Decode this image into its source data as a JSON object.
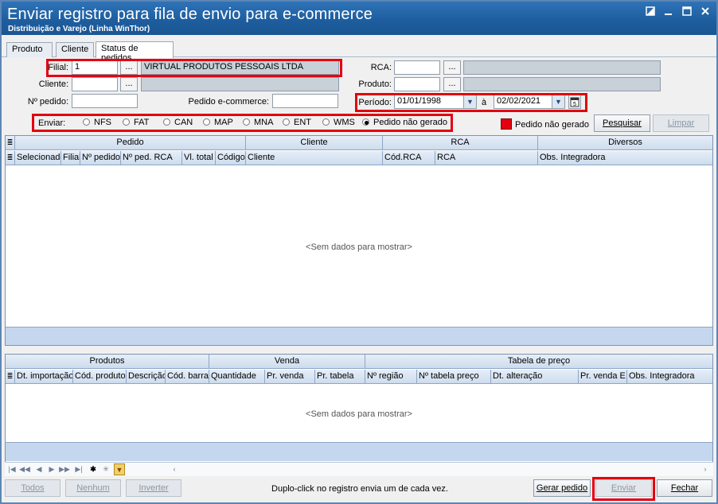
{
  "window": {
    "title": "Enviar registro para fila de envio para e-commerce",
    "subtitle": "Distribuição e Varejo (Linha WinThor)"
  },
  "tabs": [
    "Produto",
    "Cliente",
    "Status de pedidos"
  ],
  "filters": {
    "filial_label": "Filial:",
    "filial_value": "1",
    "filial_name": "VIRTUAL PRODUTOS PESSOAIS LTDA",
    "cliente_label": "Cliente:",
    "cliente_value": "",
    "pedido_label": "Nº pedido:",
    "pedido_value": "",
    "pedido_ecom_label": "Pedido e-commerce:",
    "pedido_ecom_value": "",
    "rca_label": "RCA:",
    "rca_value": "",
    "produto_label": "Produto:",
    "produto_value": "",
    "periodo_label": "Período:",
    "periodo_start": "01/01/1998",
    "periodo_sep": "à",
    "periodo_end": "02/02/2021",
    "dots": "..."
  },
  "enviar": {
    "label": "Enviar:",
    "options": [
      "NFS",
      "FAT",
      "CAN",
      "MAP",
      "MNA",
      "ENT",
      "WMS",
      "Pedido não gerado"
    ],
    "selected": "Pedido não gerado"
  },
  "legend": {
    "color": "#e3000f",
    "label": "Pedido não gerado"
  },
  "buttons": {
    "pesquisar": "Pesquisar",
    "limpar": "Limpar"
  },
  "grid1": {
    "bands": [
      "Pedido",
      "Cliente",
      "RCA",
      "Diversos"
    ],
    "columns": [
      "Selecionado",
      "Filial",
      "Nº pedido",
      "Nº ped. RCA",
      "Vl. total",
      "Código",
      "Cliente",
      "Cód.RCA",
      "RCA",
      "Obs. Integradora"
    ],
    "empty": "<Sem dados para mostrar>"
  },
  "grid2": {
    "bands": [
      "Produtos",
      "Venda",
      "Tabela de preço"
    ],
    "columns": [
      "Dt. importação",
      "Cód. produto",
      "Descrição",
      "Cód. barras",
      "Quantidade",
      "Pr. venda",
      "Pr. tabela",
      "Nº região",
      "Nº tabela preço",
      "Dt. alteração",
      "Pr. venda E",
      "Obs. Integradora"
    ],
    "empty": "<Sem dados para mostrar>"
  },
  "bottom": {
    "todos": "Todos",
    "nenhum": "Nenhum",
    "inverter": "Inverter",
    "hint": "Duplo-click no registro envia um de cada vez.",
    "gerar": "Gerar pedido",
    "enviar": "Enviar",
    "fechar": "Fechar"
  }
}
